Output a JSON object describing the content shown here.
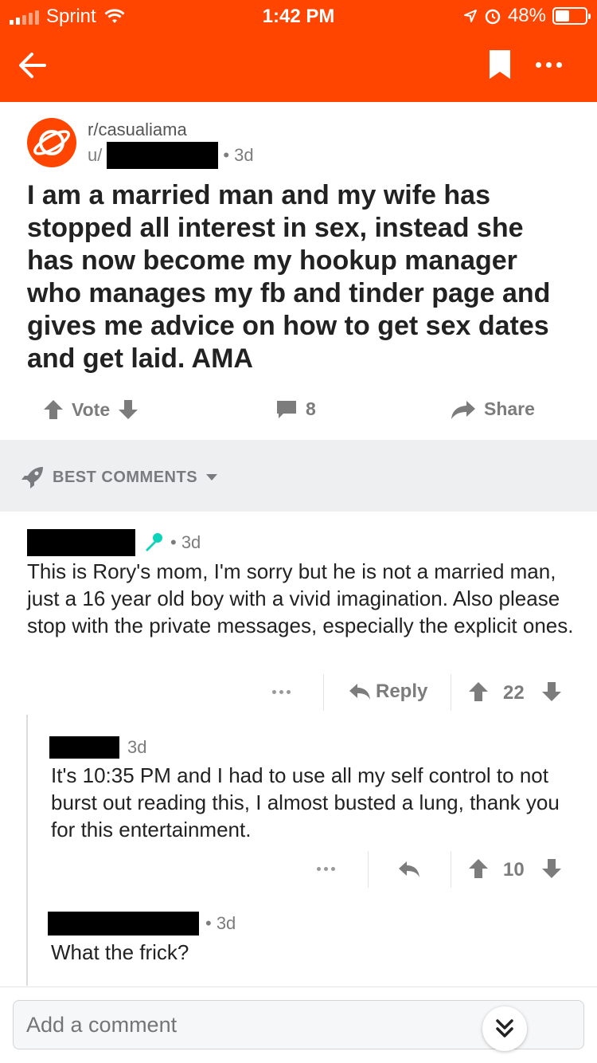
{
  "status_bar": {
    "carrier": "Sprint",
    "time": "1:42 PM",
    "battery_percent": "48%",
    "battery_level": 0.48
  },
  "post": {
    "subreddit": "r/casualiama",
    "user_prefix": "u/",
    "age": "• 3d",
    "title": "I am a married man and my wife has stopped all interest in sex, instead she has now become my hookup manager who manages my fb and tinder page and gives me advice on how to get sex dates and get laid. AMA",
    "vote_label": "Vote",
    "comment_count": "8",
    "share_label": "Share"
  },
  "sort": {
    "label": "BEST COMMENTS"
  },
  "comments": [
    {
      "age": "• 3d",
      "body": "This is Rory's mom, I'm sorry but he is not a married man, just a 16 year old boy with a vivid imagination. Also please stop with the private messages, especially the explicit ones.",
      "reply_label": "Reply",
      "score": "22"
    },
    {
      "age": "3d",
      "body": "It's 10:35 PM and I had to use all my self control to not burst out reading this, I almost busted a lung, thank you for this entertainment.",
      "score": "10"
    },
    {
      "age": "• 3d",
      "body": "What the frick?"
    }
  ],
  "comment_box": {
    "placeholder": "Add a comment"
  },
  "colors": {
    "brand": "#ff4500",
    "teal_badge": "#0dd3bb",
    "meta_gray": "#7c7c7c"
  }
}
